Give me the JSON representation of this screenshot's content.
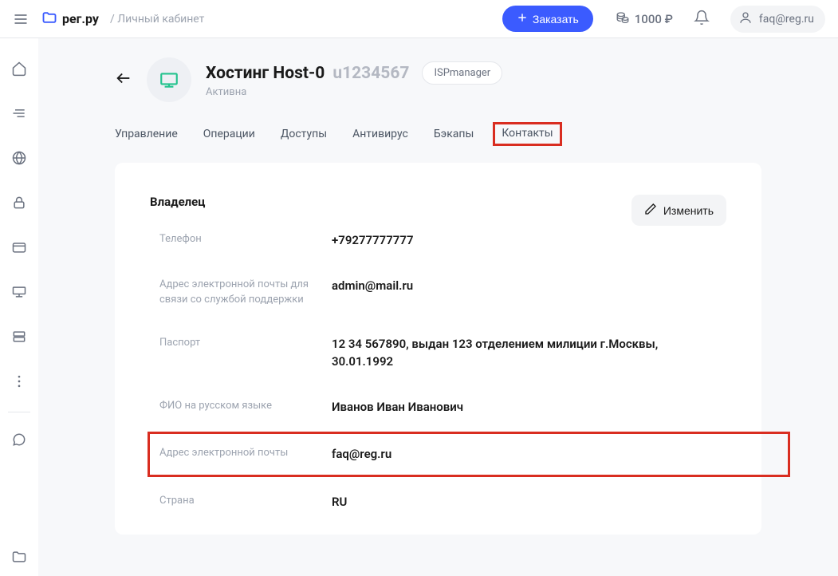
{
  "header": {
    "logo_text": "рег.ру",
    "breadcrumb": "/ Личный кабинет",
    "order_label": "Заказать",
    "balance": "1000 ₽",
    "user_email": "faq@reg.ru"
  },
  "page": {
    "title": "Хостинг Host-0",
    "service_id": "u1234567",
    "isp_label": "ISPmanager",
    "status": "Активна"
  },
  "tabs": [
    {
      "label": "Управление"
    },
    {
      "label": "Операции"
    },
    {
      "label": "Доступы"
    },
    {
      "label": "Антивирус"
    },
    {
      "label": "Бэкапы"
    },
    {
      "label": "Контакты",
      "active": true
    }
  ],
  "owner": {
    "section_title": "Владелец",
    "edit_label": "Изменить",
    "fields": [
      {
        "label": "Телефон",
        "value": "+79277777777"
      },
      {
        "label": "Адрес электронной почты для связи со службой поддержки",
        "value": "admin@mail.ru"
      },
      {
        "label": "Паспорт",
        "value": "12 34 567890, выдан 123 отделением милиции г.Москвы, 30.01.1992"
      },
      {
        "label": "ФИО на русском языке",
        "value": "Иванов Иван Иванович"
      },
      {
        "label": "Адрес электронной почты",
        "value": "faq@reg.ru",
        "highlight": true
      },
      {
        "label": "Страна",
        "value": "RU"
      }
    ]
  }
}
